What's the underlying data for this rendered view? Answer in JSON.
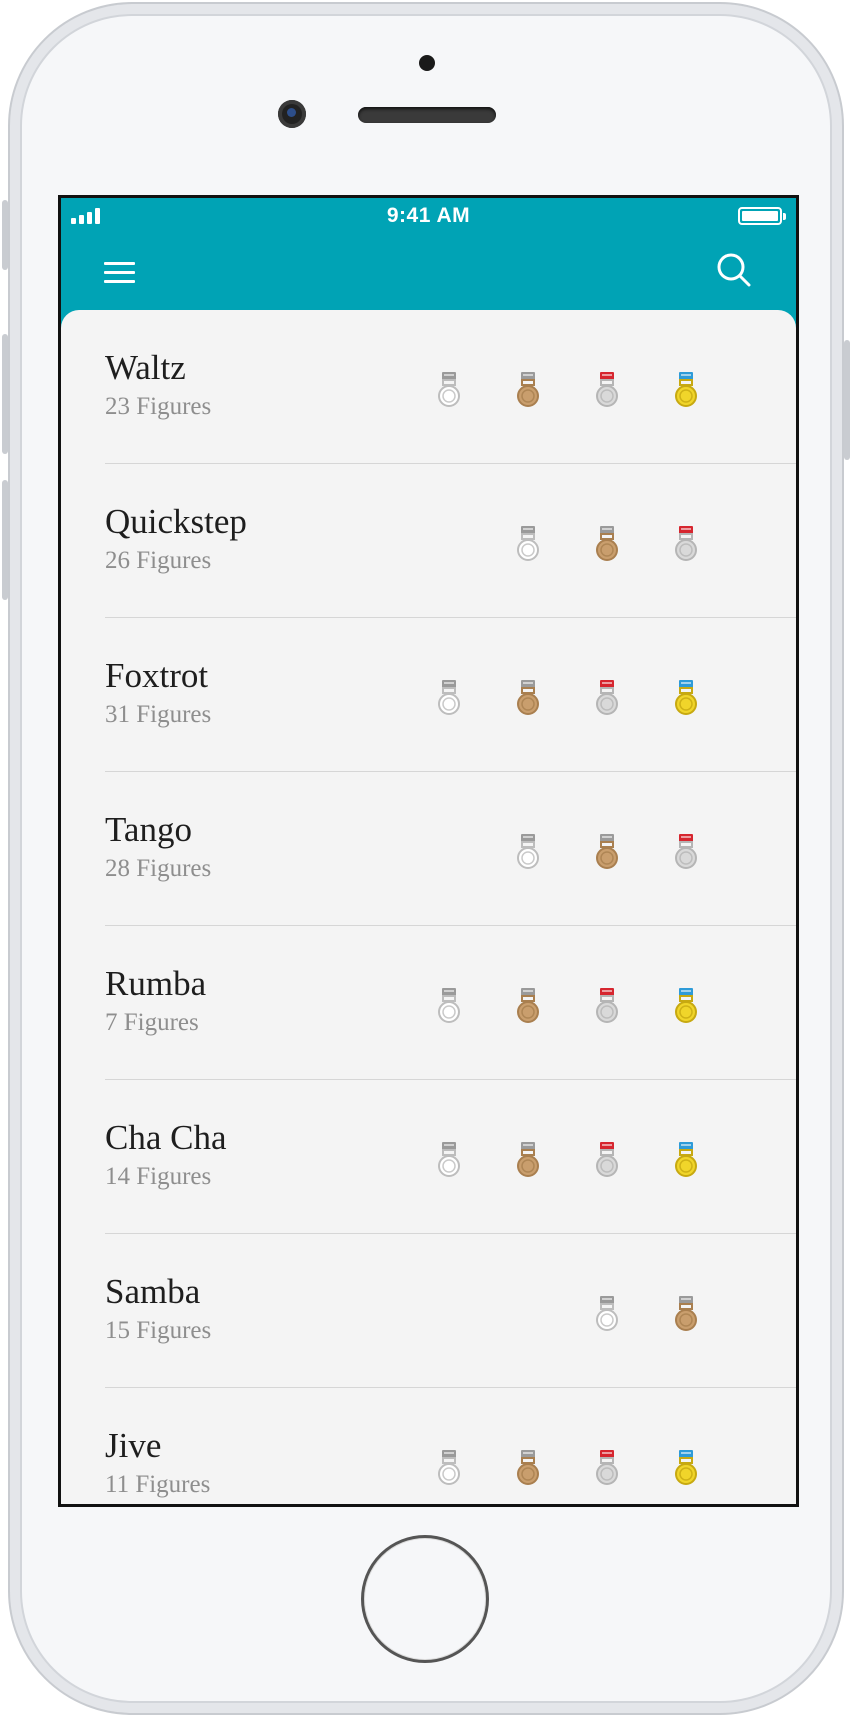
{
  "status_bar": {
    "time": "9:41 AM"
  },
  "colors": {
    "header": "#00a3b5",
    "bronze": "#c99e6d",
    "silver": "#d9d9d9",
    "gold": "#f0d52a",
    "ribbon_grey": "#9a9a9a",
    "ribbon_red": "#d6262f",
    "ribbon_blue": "#2e9bd8"
  },
  "icons": {
    "menu": "hamburger-menu-icon",
    "search": "search-icon"
  },
  "dances": [
    {
      "name": "Waltz",
      "figures": "23 Figures",
      "medals": [
        "white",
        "bronze",
        "silver",
        "gold"
      ]
    },
    {
      "name": "Quickstep",
      "figures": "26 Figures",
      "medals": [
        "white",
        "bronze",
        "silver"
      ]
    },
    {
      "name": "Foxtrot",
      "figures": "31 Figures",
      "medals": [
        "white",
        "bronze",
        "silver",
        "gold"
      ]
    },
    {
      "name": "Tango",
      "figures": "28 Figures",
      "medals": [
        "white",
        "bronze",
        "silver"
      ]
    },
    {
      "name": "Rumba",
      "figures": "7 Figures",
      "medals": [
        "white",
        "bronze",
        "silver",
        "gold"
      ]
    },
    {
      "name": "Cha Cha",
      "figures": "14 Figures",
      "medals": [
        "white",
        "bronze",
        "silver",
        "gold"
      ]
    },
    {
      "name": "Samba",
      "figures": "15 Figures",
      "medals": [
        "white",
        "bronze"
      ]
    },
    {
      "name": "Jive",
      "figures": "11 Figures",
      "medals": [
        "white",
        "bronze",
        "silver",
        "gold"
      ]
    }
  ]
}
